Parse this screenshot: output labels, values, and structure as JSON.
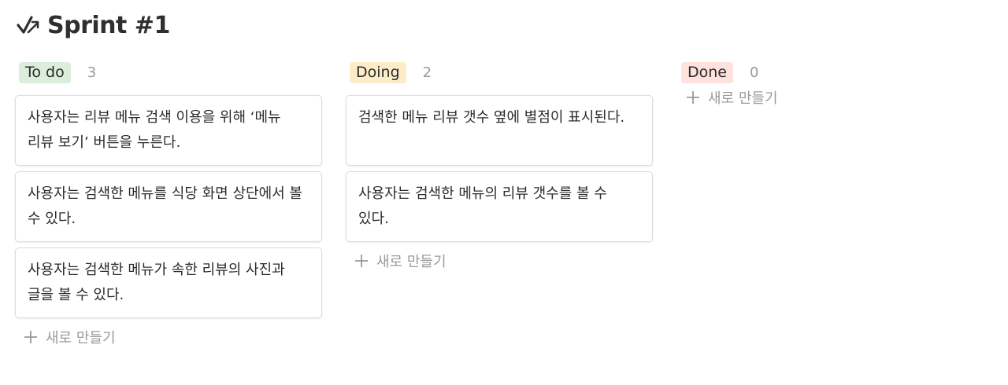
{
  "page": {
    "title": "Sprint #1",
    "icon": "sprint-check-icon"
  },
  "colors": {
    "todo_tag": "#dbeddb",
    "doing_tag": "#fdecc8",
    "done_tag": "#ffe2dd",
    "muted_text": "#9b9a97",
    "card_border": "#dcdcda"
  },
  "columns": [
    {
      "status": "To do",
      "count": "3",
      "cards": [
        "사용자는 리뷰 메뉴 검색 이용을 위해 ‘메뉴 리뷰 보기’ 버튼을 누른다.",
        "사용자는 검색한 메뉴를 식당 화면 상단에서 볼 수 있다.",
        "사용자는 검색한 메뉴가 속한 리뷰의 사진과 글을 볼 수 있다."
      ],
      "new_label": "새로 만들기"
    },
    {
      "status": "Doing",
      "count": "2",
      "cards": [
        "검색한 메뉴 리뷰 갯수 옆에 별점이 표시된다.",
        "사용자는 검색한 메뉴의 리뷰 갯수를 볼 수 있다."
      ],
      "new_label": "새로 만들기"
    },
    {
      "status": "Done",
      "count": "0",
      "cards": [],
      "new_label": "새로 만들기"
    }
  ]
}
